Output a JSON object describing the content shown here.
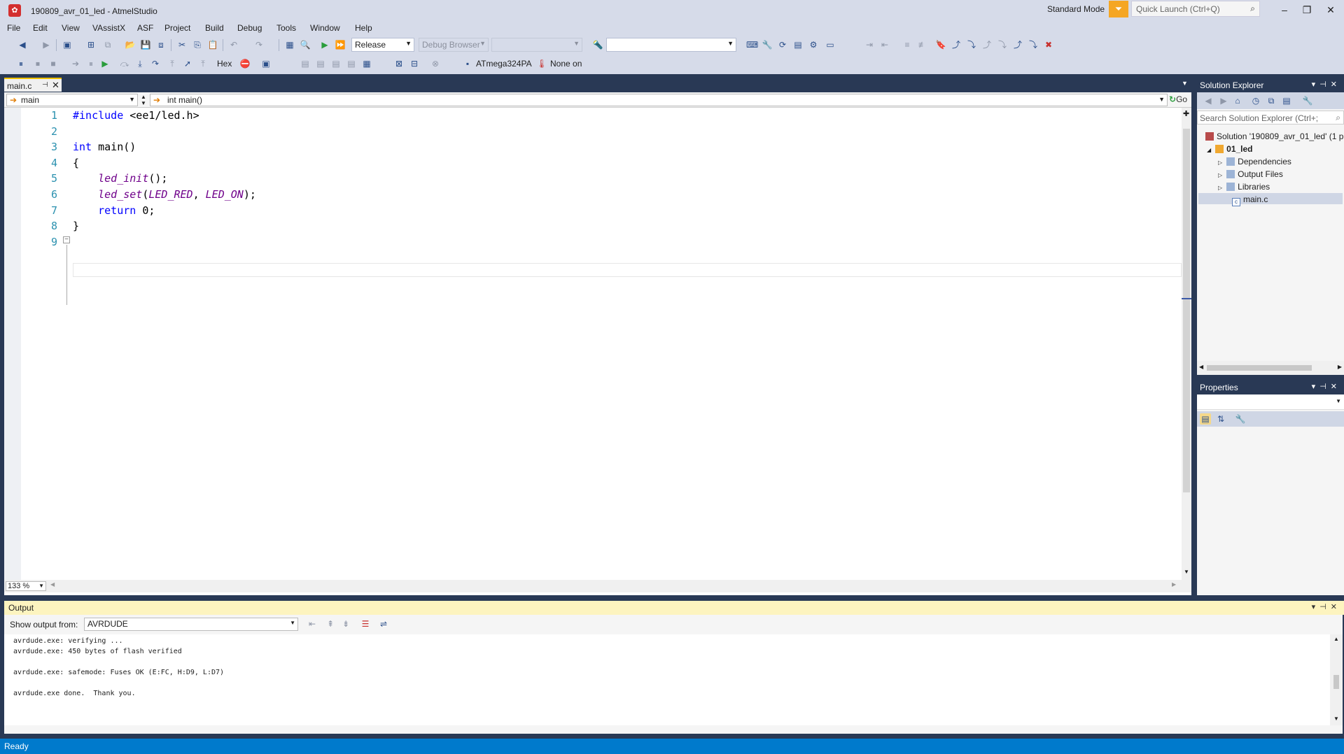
{
  "window": {
    "title": "190809_avr_01_led - AtmelStudio",
    "mode": "Standard Mode",
    "quick_launch_placeholder": "Quick Launch (Ctrl+Q)",
    "minimize": "–",
    "maximize": "❐",
    "close": "✕"
  },
  "menu": [
    "File",
    "Edit",
    "View",
    "VAssistX",
    "ASF",
    "Project",
    "Build",
    "Debug",
    "Tools",
    "Window",
    "Help"
  ],
  "toolbar": {
    "config": "Release",
    "debug_browser": "Debug Browser",
    "hex_label": "Hex",
    "device": "ATmega324PA",
    "tool": "None on"
  },
  "editor": {
    "tab": "main.c",
    "nav_left": "main",
    "nav_right": "int main()",
    "go": "Go",
    "zoom": "133 %",
    "lines": [
      {
        "n": "1"
      },
      {
        "n": "2"
      },
      {
        "n": "3"
      },
      {
        "n": "4"
      },
      {
        "n": "5"
      },
      {
        "n": "6"
      },
      {
        "n": "7"
      },
      {
        "n": "8"
      },
      {
        "n": "9"
      }
    ],
    "code": {
      "l1_kw": "#include",
      "l1_rest": " <ee1/led.h>",
      "l3_kw": "int",
      "l3_rest": " main()",
      "l4": "{",
      "l5_fn": "led_init",
      "l5_rest": "();",
      "l6_fn": "led_set",
      "l6_a": "(",
      "l6_m1": "LED_RED",
      "l6_b": ", ",
      "l6_m2": "LED_ON",
      "l6_c": ");",
      "l7_kw": "return",
      "l7_rest": " 0;",
      "l8": "}"
    }
  },
  "solution_explorer": {
    "title": "Solution Explorer",
    "search_placeholder": "Search Solution Explorer (Ctrl+;",
    "solution": "Solution '190809_avr_01_led' (1 p",
    "project": "01_led",
    "items": [
      "Dependencies",
      "Output Files",
      "Libraries"
    ],
    "file": "main.c"
  },
  "properties": {
    "title": "Properties"
  },
  "output": {
    "title": "Output",
    "show_from_label": "Show output from:",
    "source": "AVRDUDE",
    "lines": [
      "avrdude.exe: verifying ...",
      "avrdude.exe: 450 bytes of flash verified",
      "",
      "avrdude.exe: safemode: Fuses OK (E:FC, H:D9, L:D7)",
      "",
      "avrdude.exe done.  Thank you."
    ]
  },
  "status": {
    "text": "Ready"
  },
  "colors": {
    "frame": "#293955",
    "statusbar": "#007acc",
    "accent": "#f5a623",
    "keyword": "#0000ff",
    "macro": "#6f008a"
  }
}
